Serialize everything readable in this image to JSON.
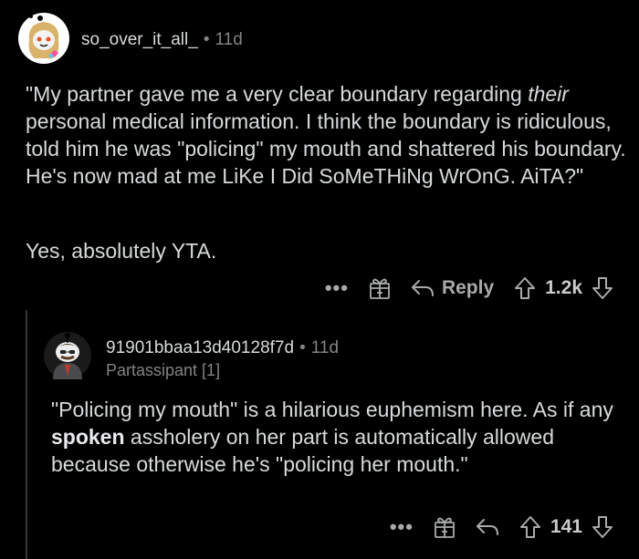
{
  "comments": [
    {
      "username": "so_over_it_all_",
      "separator": "•",
      "time": "11d",
      "body_lines": {
        "p1_a": "\"My partner gave me a very clear boundary regarding ",
        "p1_em": "their",
        "p1_b": " personal medical information. I think the boundary is ridiculous, told him he was \"policing\" my mouth and shattered his boundary. He's now mad at me LiKe I Did SoMeTHiNg WrOnG. AiTA?\"",
        "p2": "Yes, absolutely YTA."
      },
      "actions": {
        "more": "•••",
        "reply_label": "Reply",
        "vote_count": "1.2k"
      }
    },
    {
      "username": "91901bbaa13d40128f7d",
      "separator": "•",
      "time": "11d",
      "flair": "Partassipant [1]",
      "body_lines": {
        "a": "\"Policing my mouth\" is a hilarious euphemism here. As if any ",
        "bold": "spoken",
        "b": " assholery on her part is automatically allowed because otherwise he's \"policing her mouth.\""
      },
      "actions": {
        "more": "•••",
        "vote_count": "141"
      }
    }
  ],
  "icons": {
    "avatar1": "snoo-avatar-blonde-icon",
    "avatar2": "snoo-avatar-suit-icon",
    "award": "gift-icon",
    "reply": "reply-arrow-icon",
    "upvote": "upvote-arrow-icon",
    "downvote": "downvote-arrow-icon"
  }
}
